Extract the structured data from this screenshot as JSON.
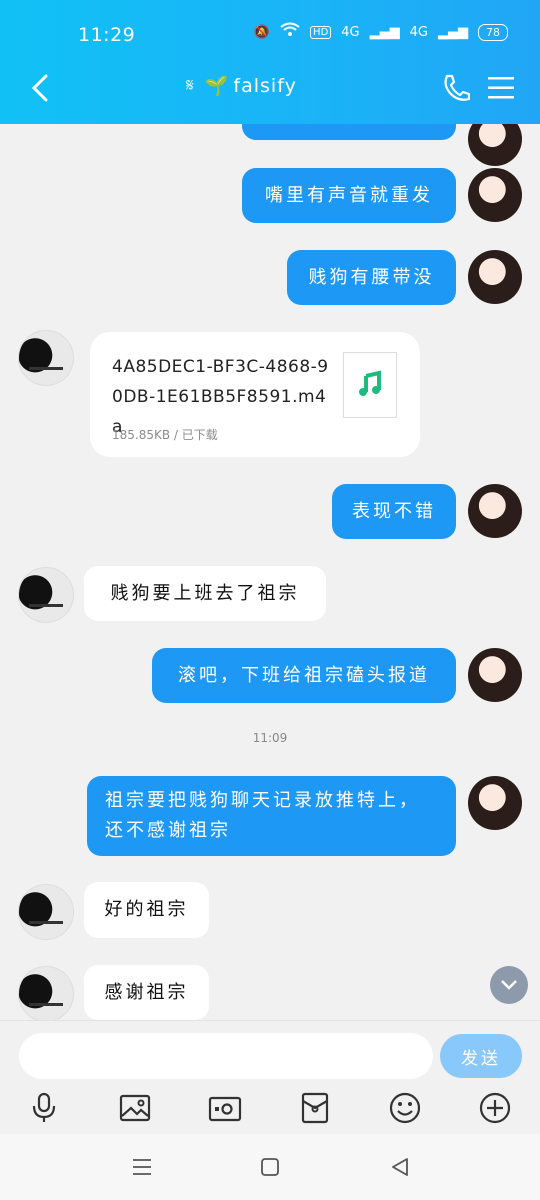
{
  "status_bar": {
    "time": "11:29",
    "hd": "HD",
    "network1": "4G",
    "network2": "4G",
    "battery": "78"
  },
  "header": {
    "title": "falsify",
    "title_prefix": "🌱",
    "ear_icon": "ear-icon"
  },
  "messages": [
    {
      "side": "out",
      "text": "嘴里有声音就重发"
    },
    {
      "side": "out",
      "text": "贱狗有腰带没"
    },
    {
      "side": "in_file",
      "file_name": "4A85DEC1-BF3C-4868-90DB-1E61BB5F8591.m4a",
      "meta": "185.85KB / 已下载"
    },
    {
      "side": "out",
      "text": "表现不错"
    },
    {
      "side": "in",
      "text": "贱狗要上班去了祖宗"
    },
    {
      "side": "out",
      "text": "滚吧，下班给祖宗磕头报道"
    },
    {
      "timestamp": "11:09"
    },
    {
      "side": "out",
      "text": "祖宗要把贱狗聊天记录放推特上，还不感谢祖宗"
    },
    {
      "side": "in",
      "text": "好的祖宗"
    },
    {
      "side": "in",
      "text": "感谢祖宗"
    }
  ],
  "input": {
    "value": "",
    "send_label": "发送"
  },
  "colors": {
    "header": "#1ab3f7",
    "bubble_out": "#1d98f5",
    "send": "#88c8fb"
  }
}
